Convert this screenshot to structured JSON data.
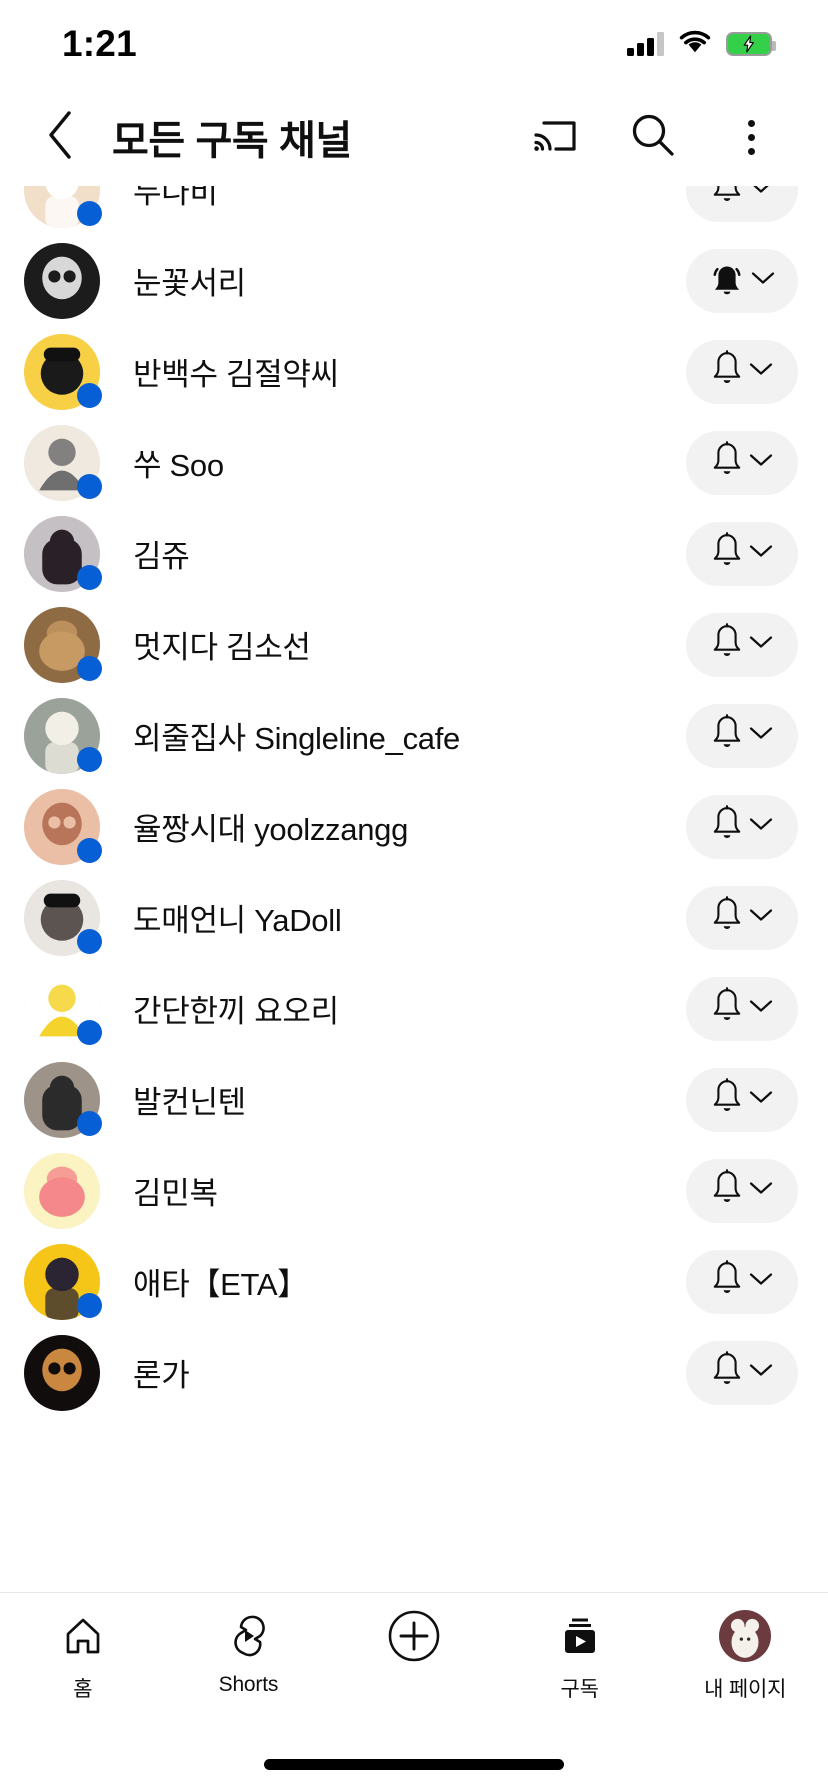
{
  "status_bar": {
    "time": "1:21",
    "signal_icon": "cellular-signal-icon",
    "wifi_icon": "wifi-icon",
    "battery_icon": "battery-charging-icon",
    "battery_color": "#35d04a"
  },
  "header": {
    "back_icon": "back-chevron-icon",
    "title": "모든 구독 채널",
    "cast_icon": "cast-icon",
    "search_icon": "search-icon",
    "overflow_icon": "kebab-menu-icon"
  },
  "accent_color": "#065fd4",
  "pill_color": "#f2f2f2",
  "channels": [
    {
      "name": "두나비",
      "has_new": true,
      "bell": "bell-outline-icon",
      "bell_state": "personalized",
      "partial_top": true,
      "avatar_bg": "#f2dfc9",
      "avatar_fg": "#ffffff"
    },
    {
      "name": "눈꽃서리",
      "has_new": false,
      "bell": "bell-filled-icon",
      "bell_state": "all",
      "partial_top": false,
      "avatar_bg": "#1c1c1c",
      "avatar_fg": "#d8d8d8"
    },
    {
      "name": "반백수 김절약씨",
      "has_new": true,
      "bell": "bell-outline-icon",
      "bell_state": "personalized",
      "partial_top": false,
      "avatar_bg": "#f7d046",
      "avatar_fg": "#1a1a1a"
    },
    {
      "name": "쑤 Soo",
      "has_new": true,
      "bell": "bell-outline-icon",
      "bell_state": "personalized",
      "partial_top": false,
      "avatar_bg": "#efe9e0",
      "avatar_fg": "#6f6f6f"
    },
    {
      "name": "김쥬",
      "has_new": true,
      "bell": "bell-outline-icon",
      "bell_state": "personalized",
      "partial_top": false,
      "avatar_bg": "#c4c0c4",
      "avatar_fg": "#2a2028"
    },
    {
      "name": "멋지다 김소선",
      "has_new": true,
      "bell": "bell-outline-icon",
      "bell_state": "personalized",
      "partial_top": false,
      "avatar_bg": "#8f6b44",
      "avatar_fg": "#c79a64"
    },
    {
      "name": "외줄집사 Singleline_cafe",
      "has_new": true,
      "bell": "bell-outline-icon",
      "bell_state": "personalized",
      "partial_top": false,
      "avatar_bg": "#9aa29a",
      "avatar_fg": "#f2efe6"
    },
    {
      "name": "율짱시대 yoolzzangg",
      "has_new": true,
      "bell": "bell-outline-icon",
      "bell_state": "personalized",
      "partial_top": false,
      "avatar_bg": "#eabfa6",
      "avatar_fg": "#b8755a"
    },
    {
      "name": "도매언니 YaDoll",
      "has_new": true,
      "bell": "bell-outline-icon",
      "bell_state": "personalized",
      "partial_top": false,
      "avatar_bg": "#e9e6e2",
      "avatar_fg": "#5c5450"
    },
    {
      "name": "간단한끼 요오리",
      "has_new": true,
      "bell": "bell-outline-icon",
      "bell_state": "personalized",
      "partial_top": false,
      "avatar_bg": "#ffffff",
      "avatar_fg": "#f5d32d"
    },
    {
      "name": "발컨닌텐",
      "has_new": true,
      "bell": "bell-outline-icon",
      "bell_state": "personalized",
      "partial_top": false,
      "avatar_bg": "#9d9388",
      "avatar_fg": "#2b2b2b"
    },
    {
      "name": "김민복",
      "has_new": false,
      "bell": "bell-outline-icon",
      "bell_state": "personalized",
      "partial_top": false,
      "avatar_bg": "#fcf3c2",
      "avatar_fg": "#f4888a"
    },
    {
      "name": "애타【ETA】",
      "has_new": true,
      "bell": "bell-outline-icon",
      "bell_state": "personalized",
      "partial_top": false,
      "avatar_bg": "#f5c518",
      "avatar_fg": "#2b2433"
    },
    {
      "name": "론가",
      "has_new": false,
      "bell": "bell-outline-icon",
      "bell_state": "personalized",
      "partial_top": false,
      "avatar_bg": "#120d0d",
      "avatar_fg": "#c9873f"
    }
  ],
  "bottom_nav": [
    {
      "label": "홈",
      "icon": "home-icon",
      "active": false
    },
    {
      "label": "Shorts",
      "icon": "shorts-icon",
      "active": false
    },
    {
      "label": "",
      "icon": "create-plus-icon",
      "active": false
    },
    {
      "label": "구독",
      "icon": "subscriptions-icon",
      "active": true
    },
    {
      "label": "내 페이지",
      "icon": "account-avatar-icon",
      "active": false
    }
  ]
}
